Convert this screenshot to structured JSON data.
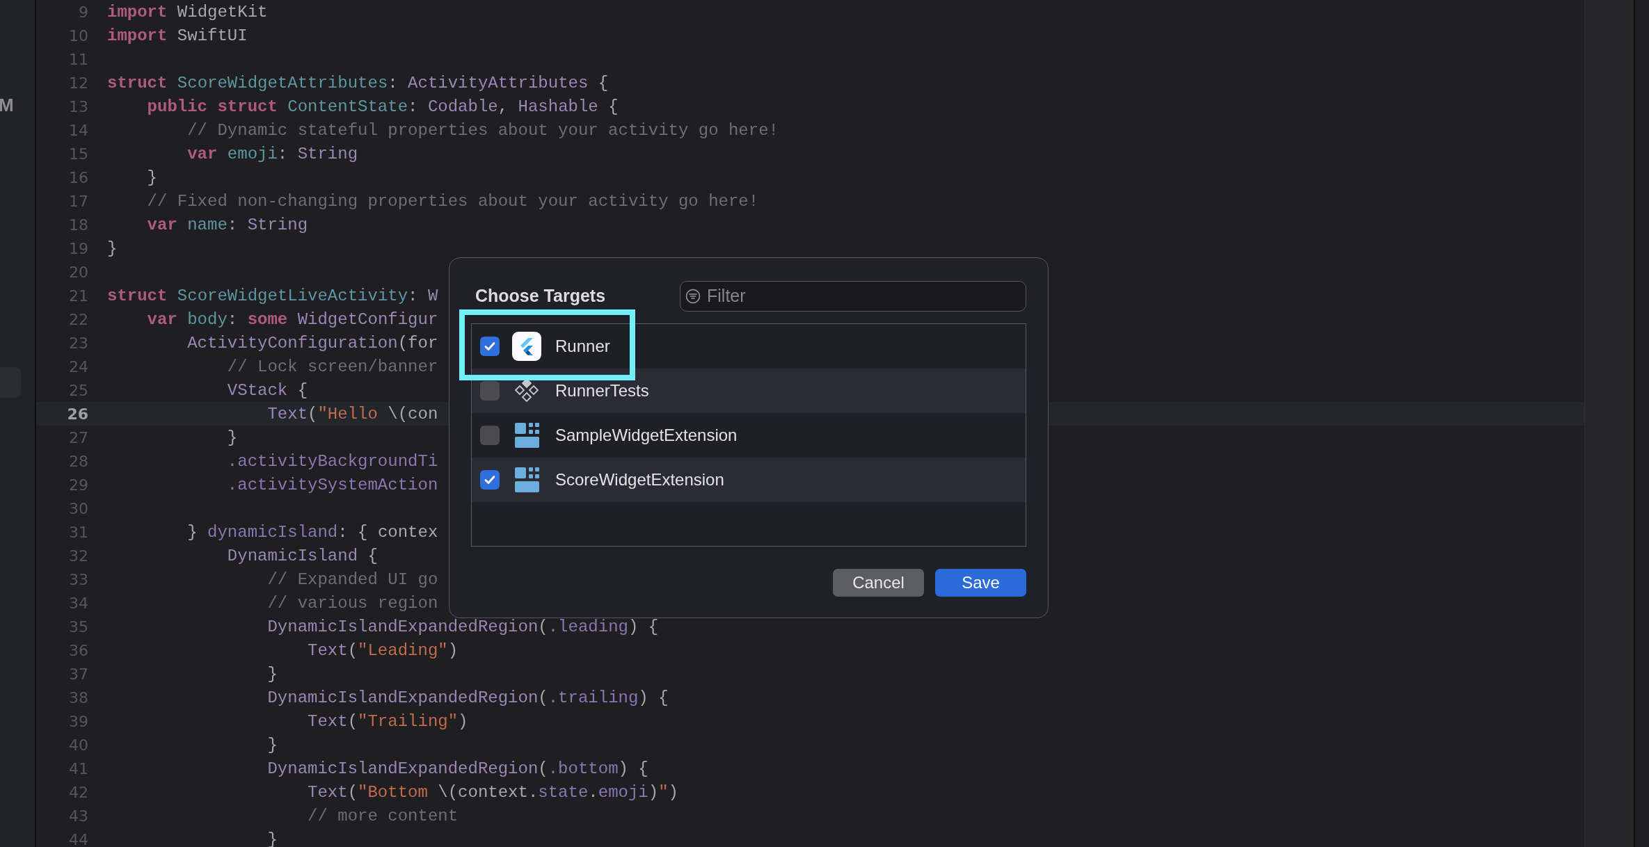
{
  "sidebar": {
    "text": "M"
  },
  "editor": {
    "lines": [
      {
        "number": "9",
        "current": false,
        "tokens": [
          {
            "kind": "kw",
            "t": "import"
          },
          {
            "kind": "plain",
            "t": " WidgetKit"
          }
        ]
      },
      {
        "number": "10",
        "current": false,
        "tokens": [
          {
            "kind": "kw",
            "t": "import"
          },
          {
            "kind": "plain",
            "t": " SwiftUI"
          }
        ]
      },
      {
        "number": "11",
        "current": false
      },
      {
        "number": "12",
        "current": false,
        "tokens": [
          {
            "kind": "kw",
            "t": "struct "
          },
          {
            "kind": "decl",
            "t": "ScoreWidgetAttributes"
          },
          {
            "kind": "plain",
            "t": ": "
          },
          {
            "kind": "type",
            "t": "ActivityAttributes"
          },
          {
            "kind": "plain",
            "t": " {"
          }
        ]
      },
      {
        "number": "13",
        "current": false,
        "tokens": [
          {
            "kind": "kw",
            "t": "    public struct "
          },
          {
            "kind": "decl",
            "t": "ContentState"
          },
          {
            "kind": "plain",
            "t": ": "
          },
          {
            "kind": "type",
            "t": "Codable"
          },
          {
            "kind": "plain",
            "t": ", "
          },
          {
            "kind": "type",
            "t": "Hashable"
          },
          {
            "kind": "plain",
            "t": " {"
          }
        ]
      },
      {
        "number": "14",
        "current": false,
        "tokens": [
          {
            "kind": "comment",
            "t": "        // Dynamic stateful properties about your activity go here!"
          }
        ]
      },
      {
        "number": "15",
        "current": false,
        "tokens": [
          {
            "kind": "kw",
            "t": "        var "
          },
          {
            "kind": "decl",
            "t": "emoji"
          },
          {
            "kind": "plain",
            "t": ": "
          },
          {
            "kind": "type",
            "t": "String"
          }
        ]
      },
      {
        "number": "16",
        "current": false,
        "tokens": [
          {
            "kind": "plain",
            "t": "    }"
          }
        ]
      },
      {
        "number": "17",
        "current": false,
        "tokens": [
          {
            "kind": "comment",
            "t": "    // Fixed non-changing properties about your activity go here!"
          }
        ]
      },
      {
        "number": "18",
        "current": false,
        "tokens": [
          {
            "kind": "kw",
            "t": "    var "
          },
          {
            "kind": "decl",
            "t": "name"
          },
          {
            "kind": "plain",
            "t": ": "
          },
          {
            "kind": "type",
            "t": "String"
          }
        ]
      },
      {
        "number": "19",
        "current": false,
        "tokens": [
          {
            "kind": "plain",
            "t": "}"
          }
        ]
      },
      {
        "number": "20",
        "current": false
      },
      {
        "number": "21",
        "current": false,
        "tokens": [
          {
            "kind": "kw",
            "t": "struct "
          },
          {
            "kind": "decl",
            "t": "ScoreWidgetLiveActivity"
          },
          {
            "kind": "plain",
            "t": ": "
          },
          {
            "kind": "type",
            "t": "W"
          }
        ]
      },
      {
        "number": "22",
        "current": false,
        "tokens": [
          {
            "kind": "kw",
            "t": "    var "
          },
          {
            "kind": "decl",
            "t": "body"
          },
          {
            "kind": "plain",
            "t": ": "
          },
          {
            "kind": "kw",
            "t": "some "
          },
          {
            "kind": "type",
            "t": "WidgetConfigur"
          }
        ]
      },
      {
        "number": "23",
        "current": false,
        "tokens": [
          {
            "kind": "type",
            "t": "        ActivityConfiguration"
          },
          {
            "kind": "plain",
            "t": "(for"
          }
        ]
      },
      {
        "number": "24",
        "current": false,
        "tokens": [
          {
            "kind": "comment",
            "t": "            // Lock screen/banner"
          }
        ]
      },
      {
        "number": "25",
        "current": false,
        "tokens": [
          {
            "kind": "type",
            "t": "            VStack"
          },
          {
            "kind": "plain",
            "t": " {"
          }
        ]
      },
      {
        "number": "26",
        "current": true,
        "tokens": [
          {
            "kind": "type",
            "t": "                Text"
          },
          {
            "kind": "plain",
            "t": "("
          },
          {
            "kind": "str",
            "t": "\"Hello "
          },
          {
            "kind": "plain",
            "t": "\\(con"
          }
        ]
      },
      {
        "number": "27",
        "current": false,
        "tokens": [
          {
            "kind": "plain",
            "t": "            }"
          }
        ]
      },
      {
        "number": "28",
        "current": false,
        "tokens": [
          {
            "kind": "prop",
            "t": "            .activityBackgroundTi"
          }
        ]
      },
      {
        "number": "29",
        "current": false,
        "tokens": [
          {
            "kind": "prop",
            "t": "            .activitySystemAction"
          }
        ]
      },
      {
        "number": "30",
        "current": false
      },
      {
        "number": "31",
        "current": false,
        "tokens": [
          {
            "kind": "plain",
            "t": "        } "
          },
          {
            "kind": "prop",
            "t": "dynamicIsland"
          },
          {
            "kind": "plain",
            "t": ": { contex"
          }
        ]
      },
      {
        "number": "32",
        "current": false,
        "tokens": [
          {
            "kind": "type",
            "t": "            DynamicIsland"
          },
          {
            "kind": "plain",
            "t": " {"
          }
        ]
      },
      {
        "number": "33",
        "current": false,
        "tokens": [
          {
            "kind": "comment",
            "t": "                // Expanded UI go"
          }
        ]
      },
      {
        "number": "34",
        "current": false,
        "tokens": [
          {
            "kind": "comment",
            "t": "                // various region"
          }
        ]
      },
      {
        "number": "35",
        "current": false,
        "tokens": [
          {
            "kind": "type",
            "t": "                DynamicIslandExpandedRegion"
          },
          {
            "kind": "plain",
            "t": "("
          },
          {
            "kind": "prop",
            "t": ".leading"
          },
          {
            "kind": "plain",
            "t": ") {"
          }
        ]
      },
      {
        "number": "36",
        "current": false,
        "tokens": [
          {
            "kind": "type",
            "t": "                    Text"
          },
          {
            "kind": "plain",
            "t": "("
          },
          {
            "kind": "str",
            "t": "\"Leading\""
          },
          {
            "kind": "plain",
            "t": ")"
          }
        ]
      },
      {
        "number": "37",
        "current": false,
        "tokens": [
          {
            "kind": "plain",
            "t": "                }"
          }
        ]
      },
      {
        "number": "38",
        "current": false,
        "tokens": [
          {
            "kind": "type",
            "t": "                DynamicIslandExpandedRegion"
          },
          {
            "kind": "plain",
            "t": "("
          },
          {
            "kind": "prop",
            "t": ".trailing"
          },
          {
            "kind": "plain",
            "t": ") {"
          }
        ]
      },
      {
        "number": "39",
        "current": false,
        "tokens": [
          {
            "kind": "type",
            "t": "                    Text"
          },
          {
            "kind": "plain",
            "t": "("
          },
          {
            "kind": "str",
            "t": "\"Trailing\""
          },
          {
            "kind": "plain",
            "t": ")"
          }
        ]
      },
      {
        "number": "40",
        "current": false,
        "tokens": [
          {
            "kind": "plain",
            "t": "                }"
          }
        ]
      },
      {
        "number": "41",
        "current": false,
        "tokens": [
          {
            "kind": "type",
            "t": "                DynamicIslandExpandedRegion"
          },
          {
            "kind": "plain",
            "t": "("
          },
          {
            "kind": "prop",
            "t": ".bottom"
          },
          {
            "kind": "plain",
            "t": ") {"
          }
        ]
      },
      {
        "number": "42",
        "current": false,
        "tokens": [
          {
            "kind": "type",
            "t": "                    Text"
          },
          {
            "kind": "plain",
            "t": "("
          },
          {
            "kind": "str",
            "t": "\"Bottom "
          },
          {
            "kind": "plain",
            "t": "\\(context."
          },
          {
            "kind": "prop",
            "t": "state"
          },
          {
            "kind": "plain",
            "t": "."
          },
          {
            "kind": "prop",
            "t": "emoji"
          },
          {
            "kind": "plain",
            "t": ")"
          },
          {
            "kind": "str",
            "t": "\""
          },
          {
            "kind": "plain",
            "t": ")"
          }
        ]
      },
      {
        "number": "43",
        "current": false,
        "tokens": [
          {
            "kind": "comment",
            "t": "                    // more content"
          }
        ]
      },
      {
        "number": "44",
        "current": false,
        "tokens": [
          {
            "kind": "plain",
            "t": "                }"
          }
        ]
      }
    ]
  },
  "dialog": {
    "title": "Choose Targets",
    "filter": {
      "placeholder": "Filter"
    },
    "targets": [
      {
        "label": "Runner",
        "kind": "app",
        "checked": true,
        "highlighted": true
      },
      {
        "label": "RunnerTests",
        "kind": "tests",
        "checked": false,
        "highlighted": false
      },
      {
        "label": "SampleWidgetExtension",
        "kind": "widget",
        "checked": false,
        "highlighted": false
      },
      {
        "label": "ScoreWidgetExtension",
        "kind": "widget",
        "checked": true,
        "highlighted": false
      }
    ],
    "buttons": [
      {
        "label": "Cancel",
        "kind": "secondary"
      },
      {
        "label": "Save",
        "kind": "primary"
      }
    ]
  }
}
